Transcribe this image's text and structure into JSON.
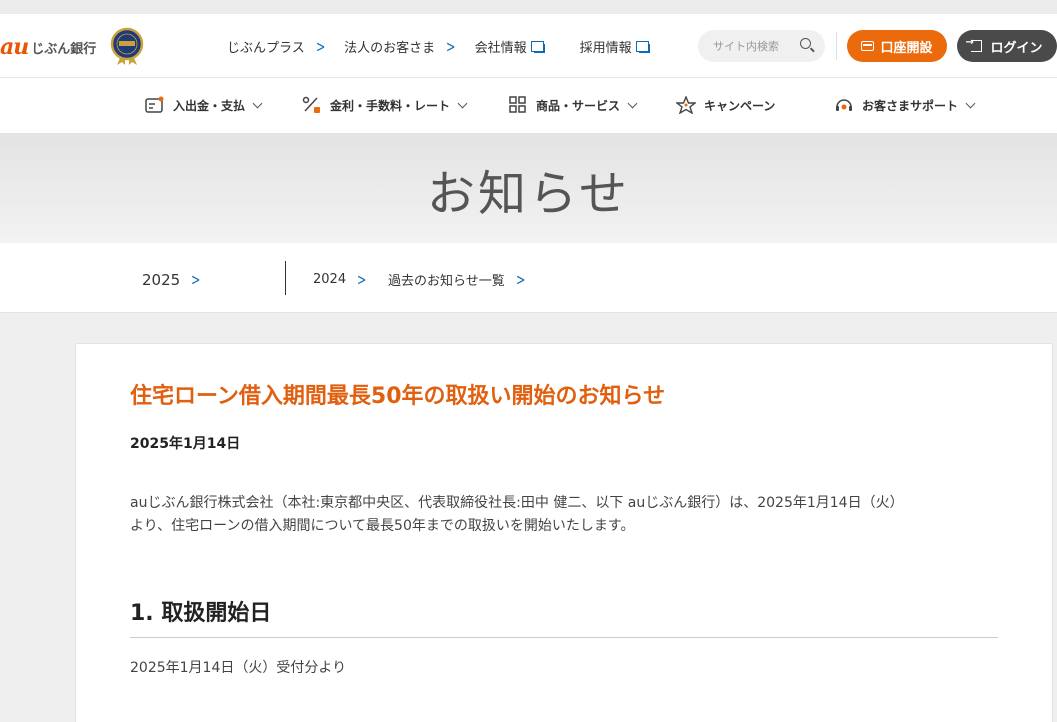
{
  "header": {
    "logo_au": "au",
    "logo_bank": "じぶん銀行",
    "links": [
      {
        "label": "じぶんプラス",
        "type": "chevron"
      },
      {
        "label": "法人のお客さま",
        "type": "chevron"
      },
      {
        "label": "会社情報",
        "type": "external"
      },
      {
        "label": "採用情報",
        "type": "external"
      }
    ],
    "search_placeholder": "サイト内検索",
    "open_account_label": "口座開設",
    "login_label": "ログイン",
    "colors": {
      "accent": "#eb6a0c",
      "login_bg": "#4a4a4a",
      "link": "#0a6cb8"
    }
  },
  "nav": {
    "items": [
      {
        "label": "入出金・支払",
        "icon": "wallet-icon"
      },
      {
        "label": "金利・手数料・レート",
        "icon": "percent-icon"
      },
      {
        "label": "商品・サービス",
        "icon": "grid-icon"
      },
      {
        "label": "キャンペーン",
        "icon": "star-icon"
      },
      {
        "label": "お客さまサポート",
        "icon": "headset-icon"
      }
    ]
  },
  "page": {
    "title": "お知らせ"
  },
  "years": {
    "current": "2025",
    "links": [
      "2024",
      "過去のお知らせ一覧"
    ]
  },
  "article": {
    "title": "住宅ローン借入期間最長50年の取扱い開始のお知らせ",
    "date": "2025年1月14日",
    "body_line1": "auじぶん銀行株式会社（本社:東京都中央区、代表取締役社長:田中 健二、以下 auじぶん銀行）は、2025年1月14日（火）",
    "body_line2": "より、住宅ローンの借入期間について最長50年までの取扱いを開始いたします。",
    "section_heading": "1. 取扱開始日",
    "section_text": "2025年1月14日（火）受付分より"
  }
}
